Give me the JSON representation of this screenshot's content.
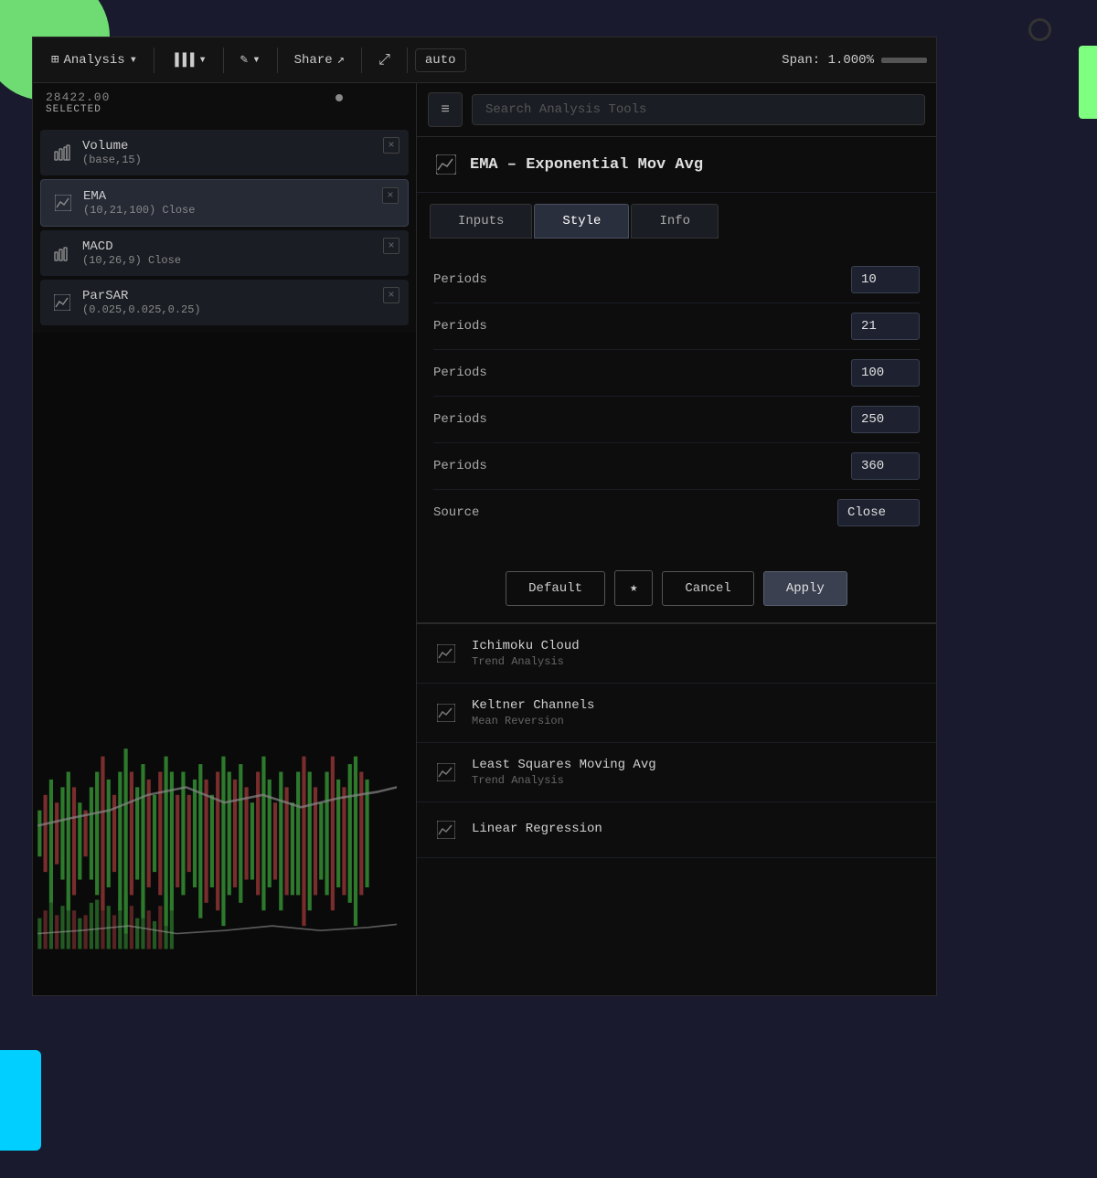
{
  "toolbar": {
    "analysis_label": "Analysis",
    "analysis_icon": "⊞",
    "chart_icon": "|||",
    "draw_icon": "✎",
    "share_label": "Share",
    "share_icon": "↗",
    "expand_icon": "⤢",
    "auto_label": "auto",
    "span_label": "Span: 1.000%"
  },
  "left_panel": {
    "selected_label": "SELECTED",
    "selected_price": "28422.00",
    "indicators": [
      {
        "id": "volume",
        "name": "Volume",
        "params": "(base,15)",
        "icon": "bar-chart"
      },
      {
        "id": "ema",
        "name": "EMA",
        "params": "(10,21,100) Close",
        "icon": "ema-chart",
        "active": true
      },
      {
        "id": "macd",
        "name": "MACD",
        "params": "(10,26,9) Close",
        "icon": "bar-chart"
      },
      {
        "id": "parsar",
        "name": "ParSAR",
        "params": "(0.025,0.025,0.25)",
        "icon": "ema-chart"
      }
    ]
  },
  "right_panel": {
    "search_placeholder": "Search Analysis Tools",
    "filter_icon": "≡",
    "ema_title": "EMA – Exponential Mov Avg",
    "tabs": [
      {
        "id": "inputs",
        "label": "Inputs",
        "active": false
      },
      {
        "id": "style",
        "label": "Style",
        "active": true
      },
      {
        "id": "info",
        "label": "Info",
        "active": false
      }
    ],
    "form_fields": [
      {
        "label": "Periods",
        "value": "10",
        "type": "input"
      },
      {
        "label": "Periods",
        "value": "21",
        "type": "input"
      },
      {
        "label": "Periods",
        "value": "100",
        "type": "input"
      },
      {
        "label": "Periods",
        "value": "250",
        "type": "input"
      },
      {
        "label": "Periods",
        "value": "360",
        "type": "input"
      },
      {
        "label": "Source",
        "value": "Close",
        "type": "select"
      }
    ],
    "buttons": {
      "default": "Default",
      "star": "★",
      "cancel": "Cancel",
      "apply": "Apply"
    },
    "additional_indicators": [
      {
        "name": "Ichimoku Cloud",
        "subtitle": "Trend Analysis",
        "icon": "ema-chart"
      },
      {
        "name": "Keltner Channels",
        "subtitle": "Mean Reversion",
        "icon": "ema-chart"
      },
      {
        "name": "Least Squares Moving Avg",
        "subtitle": "Trend Analysis",
        "icon": "ema-chart"
      },
      {
        "name": "Linear Regression",
        "subtitle": "",
        "icon": "ema-chart"
      }
    ]
  },
  "chart": {
    "bars": [
      3,
      5,
      8,
      4,
      6,
      9,
      7,
      5,
      3,
      6,
      8,
      10,
      7,
      5,
      9,
      12,
      8,
      6,
      10,
      7,
      5,
      8,
      11,
      9,
      6,
      8,
      5,
      7,
      10,
      8,
      6,
      9,
      11,
      8,
      7,
      9,
      6,
      5,
      8,
      10,
      7,
      5,
      9,
      7,
      6,
      8,
      11,
      9,
      7,
      5,
      8,
      6,
      10,
      7,
      9,
      11,
      8,
      6
    ],
    "bar_colors": [
      "up",
      "down",
      "up",
      "down",
      "up",
      "up",
      "down",
      "up",
      "down",
      "up",
      "up",
      "down",
      "up",
      "down",
      "up",
      "up",
      "down",
      "up",
      "up",
      "down",
      "up",
      "down",
      "up",
      "up",
      "down",
      "up",
      "down",
      "up",
      "up",
      "down",
      "up",
      "down",
      "up",
      "up",
      "down",
      "up",
      "down",
      "up",
      "down",
      "up",
      "up",
      "down",
      "up",
      "down",
      "up",
      "up",
      "down",
      "up",
      "down",
      "up",
      "up",
      "down",
      "up",
      "down",
      "up",
      "up",
      "down",
      "up"
    ]
  }
}
